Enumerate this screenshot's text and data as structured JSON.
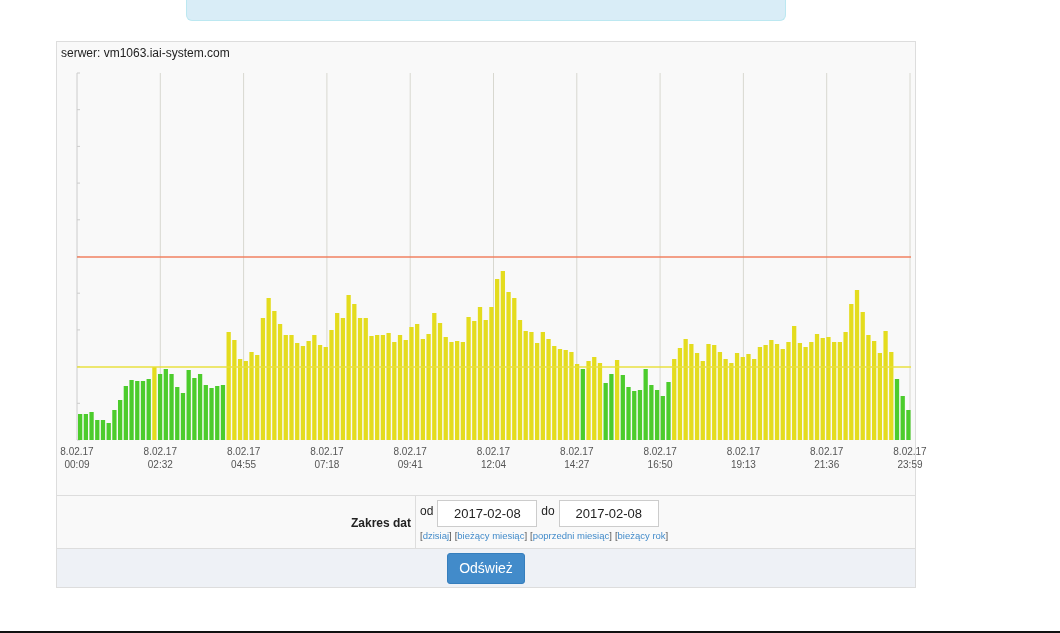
{
  "chart_panel": {
    "server_label": "serwer: vm1063.iai-system.com",
    "x_labels": [
      {
        "date": "8.02.17",
        "time": "00:09"
      },
      {
        "date": "8.02.17",
        "time": "02:32"
      },
      {
        "date": "8.02.17",
        "time": "04:55"
      },
      {
        "date": "8.02.17",
        "time": "07:18"
      },
      {
        "date": "8.02.17",
        "time": "09:41"
      },
      {
        "date": "8.02.17",
        "time": "12:04"
      },
      {
        "date": "8.02.17",
        "time": "14:27"
      },
      {
        "date": "8.02.17",
        "time": "16:50"
      },
      {
        "date": "8.02.17",
        "time": "19:13"
      },
      {
        "date": "8.02.17",
        "time": "21:36"
      },
      {
        "date": "8.02.17",
        "time": "23:59"
      }
    ]
  },
  "date_form": {
    "label": "Zakres dat",
    "from_label": "od",
    "from_value": "2017-02-08",
    "to_label": "do",
    "to_value": "2017-02-08",
    "quick_links": [
      "[dzisiaj]",
      "[bieżący miesiąc]",
      "[poprzedni miesiąc]",
      "[bieżący rok]"
    ],
    "refresh_button": "Odśwież"
  }
}
